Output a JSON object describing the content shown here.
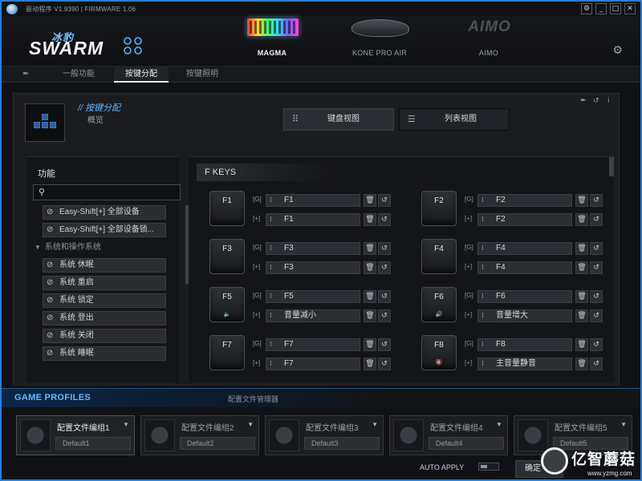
{
  "window": {
    "version_text": "驱动程序 V1.9390 | FIRMWARE 1.06",
    "buttons": [
      "⚙",
      "_",
      "□",
      "✕"
    ]
  },
  "header": {
    "logo_cn": "冰豹",
    "logo_text": "SWARM",
    "devices": [
      {
        "name": "MAGMA",
        "active": true
      },
      {
        "name": "KONE PRO AIR",
        "active": false
      },
      {
        "name": "AIMO",
        "active": false
      }
    ],
    "aimo_logo": "AIMO"
  },
  "tabs": [
    {
      "label": "一般功能",
      "active": false
    },
    {
      "label": "按键分配",
      "active": true
    },
    {
      "label": "按键照明",
      "active": false
    }
  ],
  "main": {
    "breadcrumb": "// 按键分配",
    "mode": "概览",
    "toolbar_icons": [
      "pin-icon",
      "reset-icon",
      "info-icon"
    ],
    "view_buttons": [
      {
        "label": "键盘视图",
        "active": false
      },
      {
        "label": "列表视图",
        "active": true
      }
    ]
  },
  "functions": {
    "title": "功能",
    "search_placeholder": "",
    "items": [
      {
        "type": "item",
        "label": "Easy-Shift[+] 全部设备"
      },
      {
        "type": "item",
        "label": "Easy-Shift[+] 全部设备锁..."
      },
      {
        "type": "category",
        "label": "系统和操作系统"
      },
      {
        "type": "item",
        "label": "系统 休眠"
      },
      {
        "type": "item",
        "label": "系统 重启"
      },
      {
        "type": "item",
        "label": "系统 锁定"
      },
      {
        "type": "item",
        "label": "系统 登出"
      },
      {
        "type": "item",
        "label": "系统 关闭"
      },
      {
        "type": "item",
        "label": "系统 睡眠"
      }
    ]
  },
  "fkeys": {
    "title": "F KEYS",
    "tag_g": "[G]",
    "tag_plus": "[+]",
    "keys": [
      {
        "cap": "F1",
        "g": "F1",
        "plus": "F1",
        "icon": ""
      },
      {
        "cap": "F2",
        "g": "F2",
        "plus": "F2",
        "icon": ""
      },
      {
        "cap": "F3",
        "g": "F3",
        "plus": "F3",
        "icon": ""
      },
      {
        "cap": "F4",
        "g": "F4",
        "plus": "F4",
        "icon": ""
      },
      {
        "cap": "F5",
        "g": "F5",
        "plus": "音量减小",
        "icon": "🔈"
      },
      {
        "cap": "F6",
        "g": "F6",
        "plus": "音量增大",
        "icon": "🔊"
      },
      {
        "cap": "F7",
        "g": "F7",
        "plus": "F7",
        "icon": ""
      },
      {
        "cap": "F8",
        "g": "F8",
        "plus": "主音量静音",
        "icon": "🔇"
      }
    ]
  },
  "game_profiles": {
    "title": "GAME PROFILES",
    "manager": "配置文件管理器",
    "slots": [
      {
        "name": "配置文件编组1",
        "default": "Default1",
        "active": true
      },
      {
        "name": "配置文件编组2",
        "default": "Default2",
        "active": false
      },
      {
        "name": "配置文件编组3",
        "default": "Default3",
        "active": false
      },
      {
        "name": "配置文件编组4",
        "default": "Default4",
        "active": false
      },
      {
        "name": "配置文件编组5",
        "default": "Default5",
        "active": false
      }
    ],
    "auto_apply": "AUTO APPLY",
    "ok_label": "确定"
  },
  "watermark": {
    "text": "亿智蘑菇",
    "url": "www.yzmg.com"
  },
  "colors": {
    "accent": "#2a7fd3",
    "highlight": "#5fb6ff",
    "panel": "#1a1c20"
  }
}
